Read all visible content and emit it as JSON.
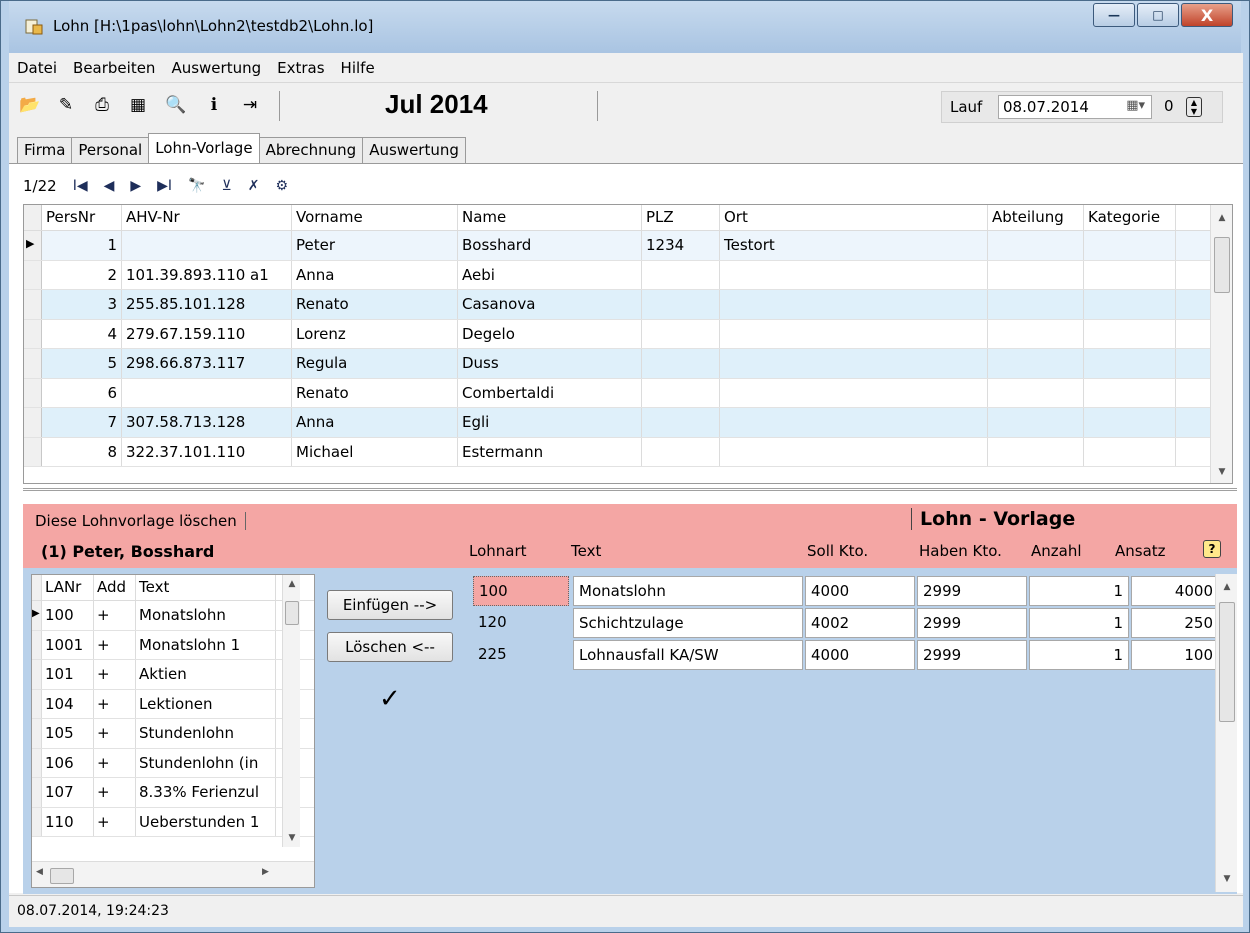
{
  "window": {
    "title": "Lohn [H:\\1pas\\lohn\\Lohn2\\testdb2\\Lohn.lo]",
    "minimize_glyph": "—",
    "maximize_glyph": "□",
    "close_glyph": "X"
  },
  "menu": [
    "Datei",
    "Bearbeiten",
    "Auswertung",
    "Extras",
    "Hilfe"
  ],
  "toolbar": {
    "icons": [
      "open-folder-icon",
      "delete-doc-icon",
      "print-icon",
      "calculator-icon",
      "search-icon",
      "info-icon",
      "exit-icon"
    ],
    "icon_glyphs": [
      "📂",
      "✎",
      "⎙",
      "▦",
      "🔍",
      "ℹ",
      "⇥"
    ],
    "period": "Jul 2014",
    "lauf_label": "Lauf",
    "lauf_date": "08.07.2014",
    "calendar_glyph": "▦▾",
    "lauf_number": "0",
    "spin_glyph_up": "▲",
    "spin_glyph_down": "▼"
  },
  "tabs": [
    "Firma",
    "Personal",
    "Lohn-Vorlage",
    "Abrechnung",
    "Auswertung"
  ],
  "active_tab": "Lohn-Vorlage",
  "nav": {
    "record": "1/22",
    "buttons": [
      "I◀",
      "◀",
      "▶",
      "▶I",
      "🔭",
      "⊻",
      "✗",
      "⚙"
    ]
  },
  "person_grid": {
    "columns": [
      "PersNr",
      "AHV-Nr",
      "Vorname",
      "Name",
      "PLZ",
      "Ort",
      "Abteilung",
      "Kategorie"
    ],
    "rows": [
      [
        "1",
        "",
        "Peter",
        "Bosshard",
        "1234",
        "Testort",
        "",
        ""
      ],
      [
        "2",
        "101.39.893.110 a1",
        "Anna",
        "Aebi",
        "",
        "",
        "",
        ""
      ],
      [
        "3",
        "255.85.101.128",
        "Renato",
        "Casanova",
        "",
        "",
        "",
        ""
      ],
      [
        "4",
        "279.67.159.110",
        "Lorenz",
        "Degelo",
        "",
        "",
        "",
        ""
      ],
      [
        "5",
        "298.66.873.117",
        "Regula",
        "Duss",
        "",
        "",
        "",
        ""
      ],
      [
        "6",
        "",
        "Renato",
        "Combertaldi",
        "",
        "",
        "",
        ""
      ],
      [
        "7",
        "307.58.713.128",
        "Anna",
        "Egli",
        "",
        "",
        "",
        ""
      ],
      [
        "8",
        "322.37.101.110",
        "Michael",
        "Estermann",
        "",
        "",
        "",
        ""
      ]
    ]
  },
  "lower": {
    "delete_link": "Diese Lohnvorlage löschen",
    "section_title": "Lohn - Vorlage",
    "employee": "(1) Peter, Bosshard",
    "headers": {
      "lohnart": "Lohnart",
      "text": "Text",
      "soll": "Soll Kto.",
      "haben": "Haben Kto.",
      "anzahl": "Anzahl",
      "ansatz": "Ansatz"
    },
    "help": "?",
    "insert_button": "Einfügen -->",
    "remove_button": "Löschen <--",
    "check_glyph": "✓"
  },
  "lohnart_list": {
    "columns": [
      "LANr",
      "Add",
      "Text"
    ],
    "rows": [
      [
        "100",
        "+",
        "Monatslohn"
      ],
      [
        "1001",
        "+",
        "Monatslohn 1"
      ],
      [
        "101",
        "+",
        "Aktien"
      ],
      [
        "104",
        "+",
        "Lektionen"
      ],
      [
        "105",
        "+",
        "Stundenlohn"
      ],
      [
        "106",
        "+",
        "Stundenlohn (in"
      ],
      [
        "107",
        "+",
        "8.33% Ferienzul"
      ],
      [
        "110",
        "+",
        "Ueberstunden 1"
      ]
    ]
  },
  "vorlage_rows": [
    [
      "100",
      "Monatslohn",
      "4000",
      "2999",
      "1",
      "4000"
    ],
    [
      "120",
      "Schichtzulage",
      "4002",
      "2999",
      "1",
      "250"
    ],
    [
      "225",
      "Lohnausfall KA/SW",
      "4000",
      "2999",
      "1",
      "100"
    ]
  ],
  "status": "08.07.2014, 19:24:23",
  "colors": {
    "pink": "#f4a6a4",
    "blue_bg": "#b9d1ea",
    "alt_row": "#dff0fa"
  }
}
